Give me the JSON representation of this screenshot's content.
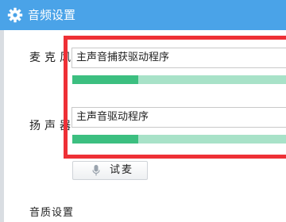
{
  "window": {
    "title": "音频设置",
    "title_icon": "gear-icon",
    "accent": "#4aa3e8"
  },
  "microphone": {
    "label": "麦克风",
    "device": "主声音捕获驱动程序",
    "level": 0.31
  },
  "speaker": {
    "label": "扬声器",
    "device": "主声音驱动程序",
    "level": 0.31
  },
  "test_button": {
    "label": "试麦",
    "icon": "microphone-icon"
  },
  "quality": {
    "label": "音质设置"
  },
  "highlight_color": "#ee3036"
}
